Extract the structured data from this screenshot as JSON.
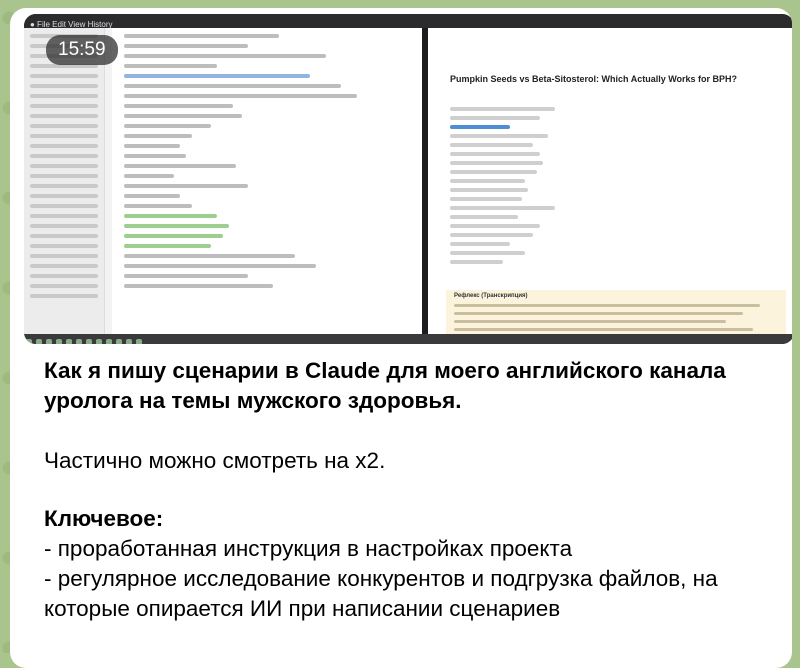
{
  "media": {
    "timestamp": "15:59",
    "right_document_title": "Pumpkin Seeds vs Beta-Sitosterol: Which Actually Works for BPH?",
    "callout_label": "Рефлекс (Транскрипция)"
  },
  "message": {
    "title": "Как я пишу сценарии в Claude для моего английского канала уролога на темы мужского здоровья.",
    "note": "Частично можно смотреть на x2.",
    "key_heading": "Ключевое:",
    "items": [
      "- проработанная инструкция в настройках проекта",
      "- регулярное исследование конкурентов и подгрузка файлов, на которые опирается ИИ при написании сценариев"
    ]
  }
}
